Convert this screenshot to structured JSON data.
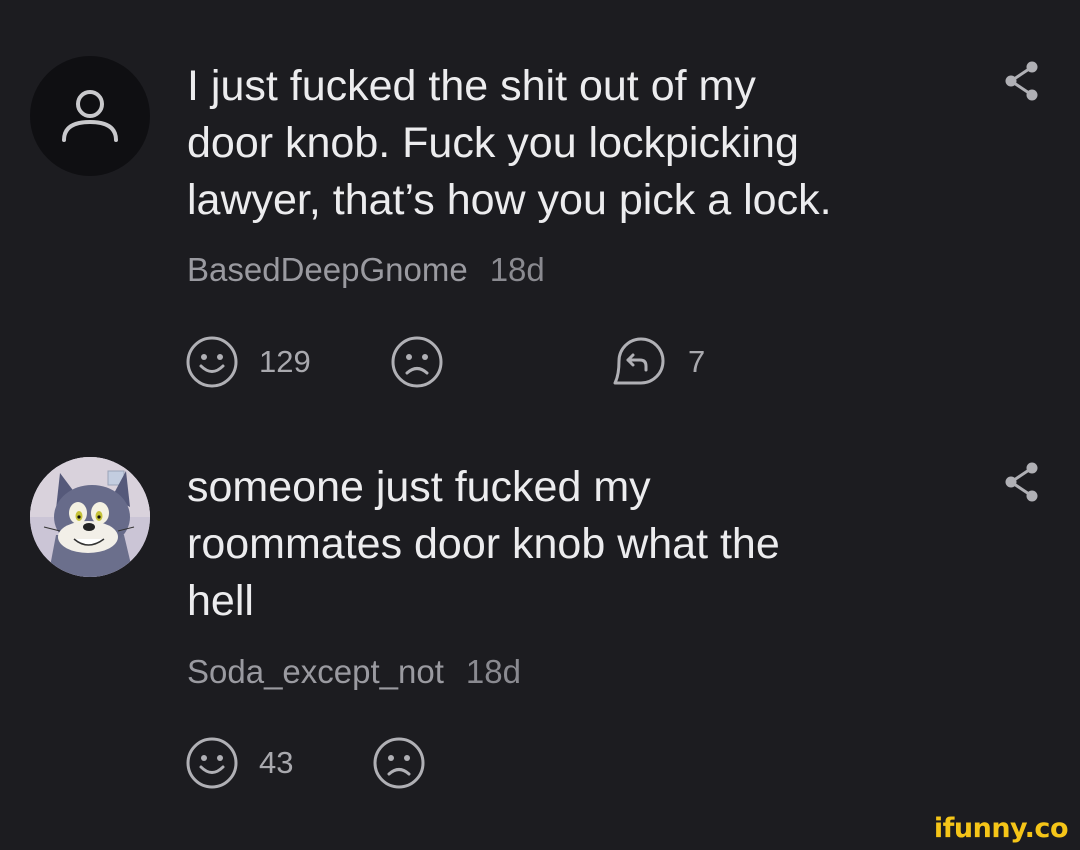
{
  "comments": [
    {
      "text_lines": [
        "I just fucked the shit out of my",
        "door knob. Fuck you lockpicking",
        "lawyer, that’s how you pick a lock."
      ],
      "username": "BasedDeepGnome",
      "time": "18d",
      "likes": "129",
      "replies": "7",
      "avatar_icon": "default-user-icon"
    },
    {
      "text_lines": [
        "someone just fucked my",
        "roommates door knob what the",
        "hell"
      ],
      "username": "Soda_except_not",
      "time": "18d",
      "likes": "43",
      "avatar_icon": "cartoon-cat-avatar"
    }
  ],
  "watermark": "ifunny.co",
  "colors": {
    "background": "#1c1c20",
    "text": "#ececee",
    "meta": "#9a9aa0",
    "icon": "#b0b0b5",
    "watermark": "#f5c518"
  }
}
